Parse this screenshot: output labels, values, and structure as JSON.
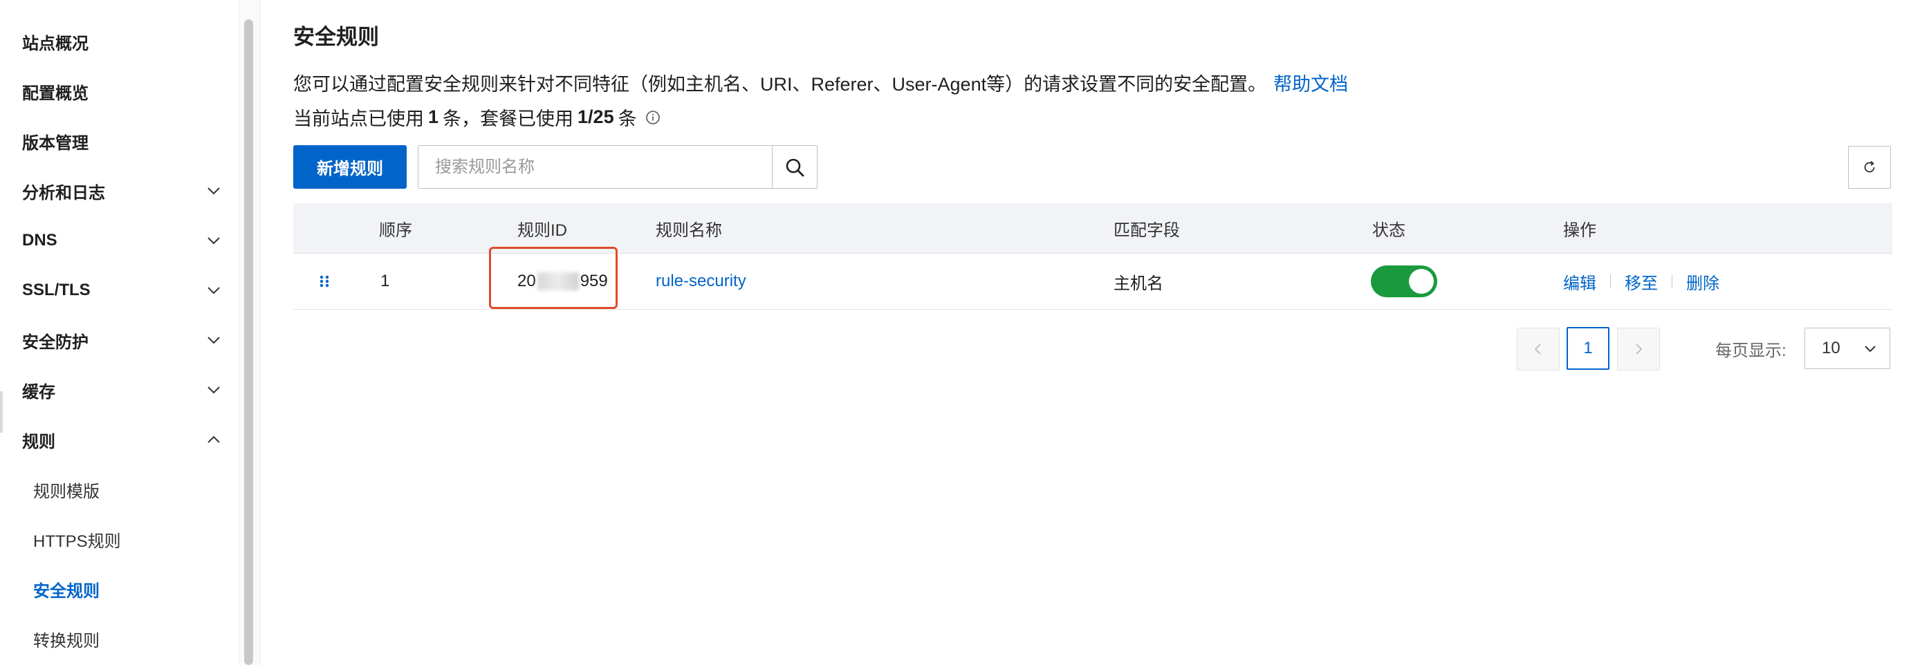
{
  "sidebar": {
    "items": [
      {
        "label": "站点概况",
        "expandable": false
      },
      {
        "label": "配置概览",
        "expandable": false
      },
      {
        "label": "版本管理",
        "expandable": false
      },
      {
        "label": "分析和日志",
        "expandable": true
      },
      {
        "label": "DNS",
        "expandable": true
      },
      {
        "label": "SSL/TLS",
        "expandable": true
      },
      {
        "label": "安全防护",
        "expandable": true
      },
      {
        "label": "缓存",
        "expandable": true
      },
      {
        "label": "规则",
        "expandable": true,
        "expanded": true
      }
    ],
    "sub_items": [
      {
        "label": "规则模版"
      },
      {
        "label": "HTTPS规则"
      },
      {
        "label": "安全规则",
        "active": true
      },
      {
        "label": "转换规则"
      }
    ]
  },
  "page": {
    "title": "安全规则",
    "description": "您可以通过配置安全规则来针对不同特征（例如主机名、URI、Referer、User-Agent等）的请求设置不同的安全配置。",
    "help_link": "帮助文档",
    "usage_prefix": "当前站点已使用",
    "usage_site_count": "1",
    "usage_mid": "条，套餐已使用",
    "usage_plan": "1/25",
    "usage_suffix": "条"
  },
  "toolbar": {
    "add_label": "新增规则",
    "search_placeholder": "搜索规则名称"
  },
  "table": {
    "headers": {
      "order": "顺序",
      "rule_id": "规则ID",
      "rule_name": "规则名称",
      "match_field": "匹配字段",
      "status": "状态",
      "actions": "操作"
    },
    "rows": [
      {
        "order": "1",
        "rule_id_prefix": "20",
        "rule_id_suffix": "959",
        "rule_name": "rule-security",
        "match_field": "主机名",
        "status_enabled": true,
        "action_edit": "编辑",
        "action_move": "移至",
        "action_delete": "删除"
      }
    ]
  },
  "pagination": {
    "current_page": "1",
    "per_page_label": "每页显示:",
    "per_page_value": "10"
  },
  "colors": {
    "primary": "#0064c8",
    "toggle_on": "#1a9a3d",
    "highlight": "#e24b2a"
  }
}
